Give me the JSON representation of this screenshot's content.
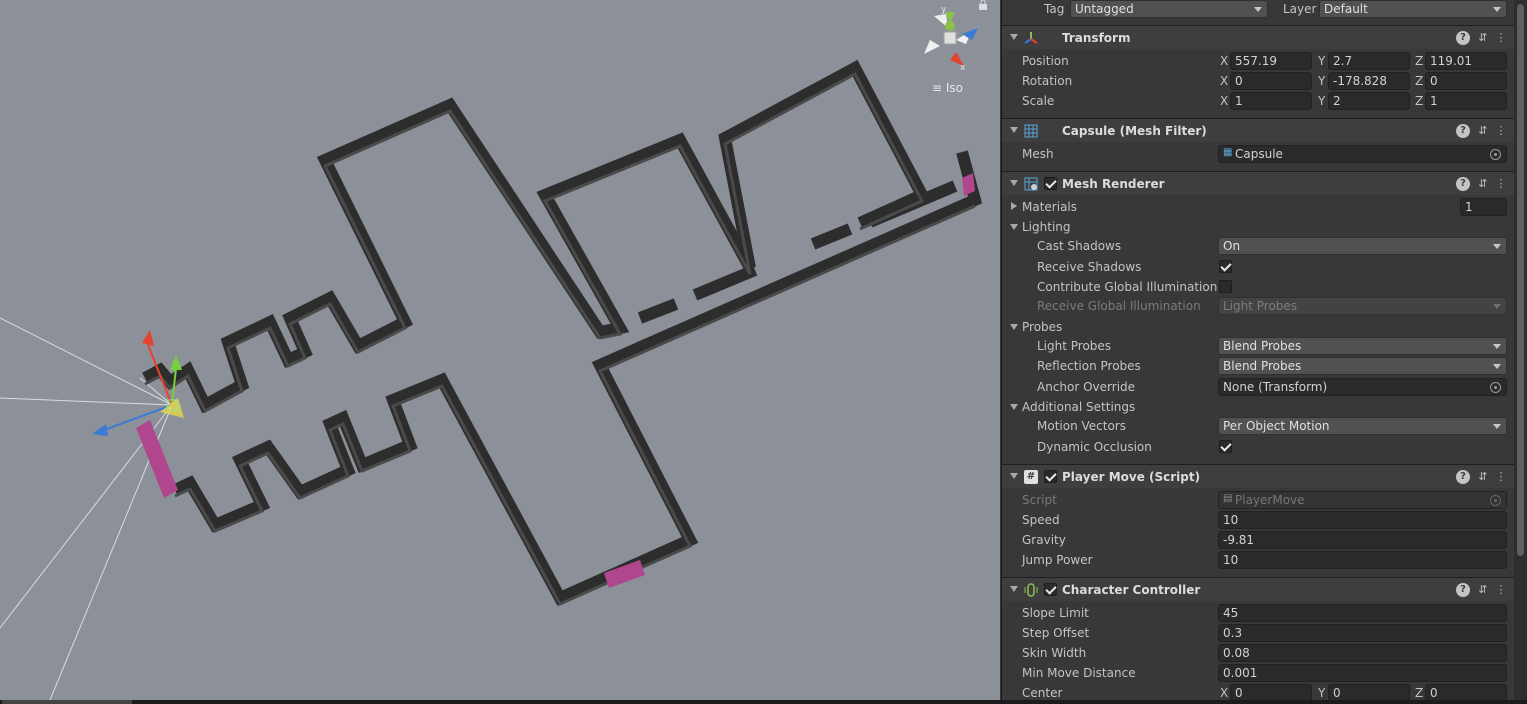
{
  "scene": {
    "projection_label": "Iso",
    "gizmo_axes": [
      "y",
      "x"
    ]
  },
  "inspector": {
    "tag_row": {
      "tag_label": "Tag",
      "tag_value": "Untagged",
      "layer_label": "Layer",
      "layer_value": "Default"
    },
    "transform": {
      "title": "Transform",
      "position": {
        "label": "Position",
        "x": "557.19",
        "y": "2.7",
        "z": "119.01"
      },
      "rotation": {
        "label": "Rotation",
        "x": "0",
        "y": "-178.828",
        "z": "0"
      },
      "scale": {
        "label": "Scale",
        "x": "1",
        "y": "2",
        "z": "1"
      },
      "axes": {
        "x": "X",
        "y": "Y",
        "z": "Z"
      }
    },
    "mesh_filter": {
      "title": "Capsule (Mesh Filter)",
      "mesh_label": "Mesh",
      "mesh_value": "Capsule"
    },
    "mesh_renderer": {
      "title": "Mesh Renderer",
      "enabled": true,
      "materials_label": "Materials",
      "materials_count": "1",
      "lighting_label": "Lighting",
      "cast_shadows_label": "Cast Shadows",
      "cast_shadows_value": "On",
      "receive_shadows_label": "Receive Shadows",
      "receive_shadows": true,
      "contribute_gi_label": "Contribute Global Illumination",
      "contribute_gi": false,
      "receive_gi_label": "Receive Global Illumination",
      "receive_gi_value": "Light Probes",
      "probes_label": "Probes",
      "light_probes_label": "Light Probes",
      "light_probes_value": "Blend Probes",
      "reflection_probes_label": "Reflection Probes",
      "reflection_probes_value": "Blend Probes",
      "anchor_override_label": "Anchor Override",
      "anchor_override_value": "None (Transform)",
      "additional_settings_label": "Additional Settings",
      "motion_vectors_label": "Motion Vectors",
      "motion_vectors_value": "Per Object Motion",
      "dynamic_occlusion_label": "Dynamic Occlusion",
      "dynamic_occlusion": true
    },
    "player_move": {
      "title": "Player Move (Script)",
      "enabled": true,
      "script_label": "Script",
      "script_value": "PlayerMove",
      "speed_label": "Speed",
      "speed_value": "10",
      "gravity_label": "Gravity",
      "gravity_value": "-9.81",
      "jump_power_label": "Jump Power",
      "jump_power_value": "10"
    },
    "character_controller": {
      "title": "Character Controller",
      "enabled": true,
      "slope_limit_label": "Slope Limit",
      "slope_limit_value": "45",
      "step_offset_label": "Step Offset",
      "step_offset_value": "0.3",
      "skin_width_label": "Skin Width",
      "skin_width_value": "0.08",
      "min_move_label": "Min Move Distance",
      "min_move_value": "0.001",
      "center_label": "Center",
      "center": {
        "x": "0",
        "y": "0",
        "z": "0"
      }
    },
    "header_buttons": {
      "help": "?",
      "presets": "⇵",
      "more": "⋮"
    }
  },
  "colors": {
    "scene_bg": "#8c9199",
    "wall_top": "#2c2c2c",
    "wall_side": "#444",
    "magenta": "#b0478e",
    "panel_bg": "#383838",
    "header_bg": "#3e3e3e",
    "field_bg": "#2a2a2a",
    "dropdown_bg": "#515151"
  }
}
